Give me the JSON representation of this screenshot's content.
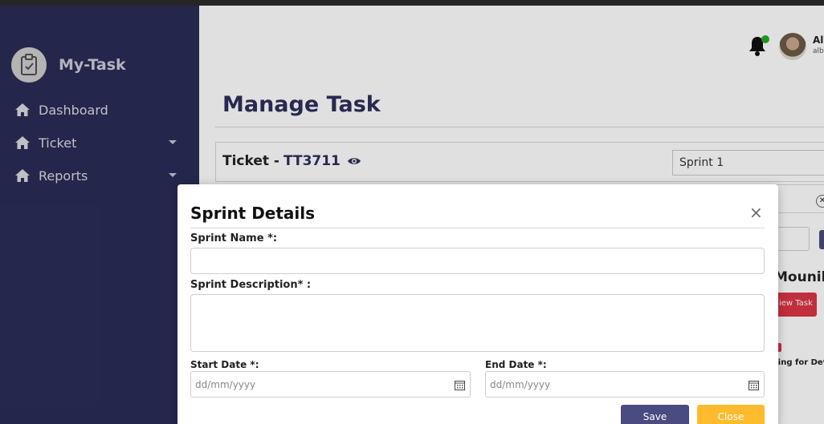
{
  "app": {
    "name": "My-Task"
  },
  "sidebar": {
    "items": [
      {
        "label": "Dashboard",
        "icon": "home-icon"
      },
      {
        "label": "Ticket",
        "icon": "home-icon",
        "has_submenu": true
      },
      {
        "label": "Reports",
        "icon": "home-icon",
        "has_submenu": true
      }
    ]
  },
  "header": {
    "user_name": "All",
    "user_email": "albe",
    "notification_status_color": "#22aa22"
  },
  "page": {
    "title": "Manage Task",
    "ticket_label": "Ticket -",
    "ticket_id": "TT3711",
    "sprint_value": "Sprint 1",
    "fragment_name": "Mounik",
    "fragment_button": "iew Task",
    "fragment_status": "ting for Dev"
  },
  "modal": {
    "title": "Sprint Details",
    "sprint_name_label": "Sprint Name *:",
    "sprint_name_value": "",
    "sprint_description_label": "Sprint Description* :",
    "sprint_description_value": "",
    "start_date_label": "Start Date *:",
    "start_date_placeholder": "dd/mm/yyyy",
    "end_date_label": "End Date *:",
    "end_date_placeholder": "dd/mm/yyyy",
    "save_label": "Save",
    "close_label": "Close"
  },
  "colors": {
    "sidebar_bg": "#2e2f5b",
    "primary": "#4a4b80",
    "accent": "#fdbb2d",
    "danger": "#dc3545"
  }
}
